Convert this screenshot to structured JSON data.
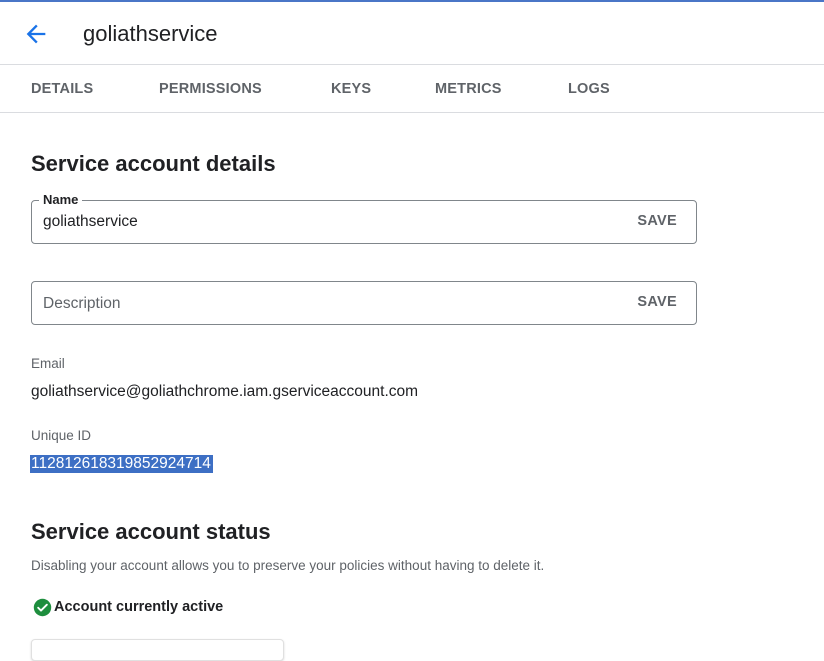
{
  "header": {
    "title": "goliathservice",
    "back_icon": "arrow-left-icon"
  },
  "tabs": [
    {
      "label": "DETAILS"
    },
    {
      "label": "PERMISSIONS"
    },
    {
      "label": "KEYS"
    },
    {
      "label": "METRICS"
    },
    {
      "label": "LOGS"
    }
  ],
  "details": {
    "heading": "Service account details",
    "name_field": {
      "label": "Name",
      "value": "goliathservice",
      "save_label": "SAVE"
    },
    "description_field": {
      "placeholder": "Description",
      "save_label": "SAVE"
    },
    "email": {
      "label": "Email",
      "value": "goliathservice@goliathchrome.iam.gserviceaccount.com"
    },
    "unique_id": {
      "label": "Unique ID",
      "value": "112812618319852924714"
    }
  },
  "status": {
    "heading": "Service account status",
    "description": "Disabling your account allows you to preserve your policies without having to delete it.",
    "state_text": "Account currently active",
    "state_icon": "check-circle-icon",
    "state_color": "#1e8e3e"
  },
  "colors": {
    "accent": "#1a73e8",
    "selection": "#3d6fc4",
    "topline": "#4a76c7"
  }
}
